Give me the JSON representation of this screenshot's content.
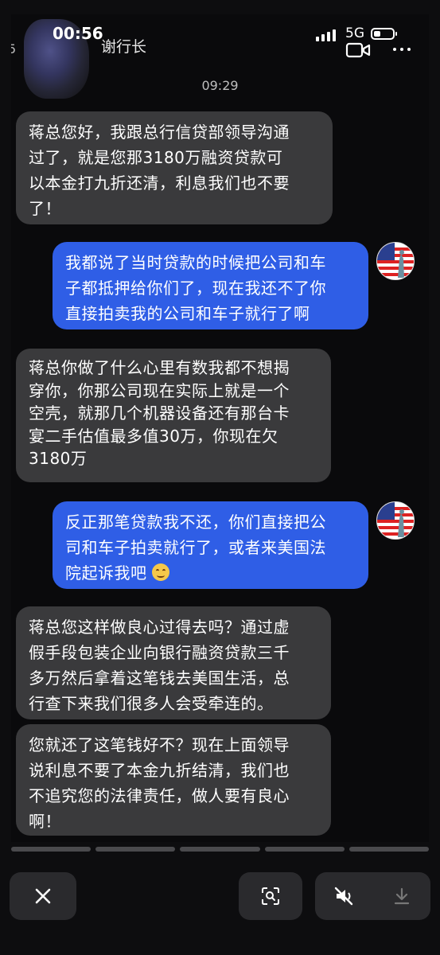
{
  "status_bar": {
    "time": "00:56",
    "network": "5G"
  },
  "chat": {
    "contact_name": "谢行长",
    "back_glyph": "5",
    "timestamp": "09:29",
    "messages": [
      {
        "side": "in",
        "lines": [
          "蒋总您好，我跟总行信贷部领导沟通",
          "过了，就是您那3180万融资贷款可",
          "以本金打九折还清，利息我们也不要",
          "了！"
        ]
      },
      {
        "side": "out",
        "lines": [
          "我都说了当时贷款的时候把公司和车",
          "子都抵押给你们了，现在我还不了你",
          "直接拍卖我的公司和车子就行了啊"
        ]
      },
      {
        "side": "in",
        "lines": [
          "蒋总你做了什么心里有数我都不想揭",
          "穿你，你那公司现在实际上就是一个",
          "空壳，就那几个机器设备还有那台卡",
          "宴二手估值最多值30万，你现在欠",
          "3180万"
        ]
      },
      {
        "side": "out",
        "lines": [
          "反正那笔贷款我不还，你们直接把公",
          "司和车子拍卖就行了，或者来美国法",
          "院起诉我吧"
        ]
      },
      {
        "side": "in",
        "lines": [
          "蒋总您这样做良心过得去吗？通过虚",
          "假手段包装企业向银行融资贷款三千",
          "多万然后拿着这笔钱去美国生活，总",
          "行查下来我们很多人会受牵连的。"
        ]
      },
      {
        "side": "in",
        "lines": [
          "您就还了这笔钱好不？现在上面领导",
          "说利息不要了本金九折结清，我们也",
          "不追究您的法律责任，做人要有良心",
          "啊！"
        ]
      }
    ]
  },
  "icons": {
    "video": "video-camera-icon",
    "more": "more-dots-icon",
    "close": "close-icon",
    "scan": "scan-icon",
    "mute": "speaker-muted-icon",
    "download": "download-icon",
    "emoji": "smiling-face-emoji"
  }
}
